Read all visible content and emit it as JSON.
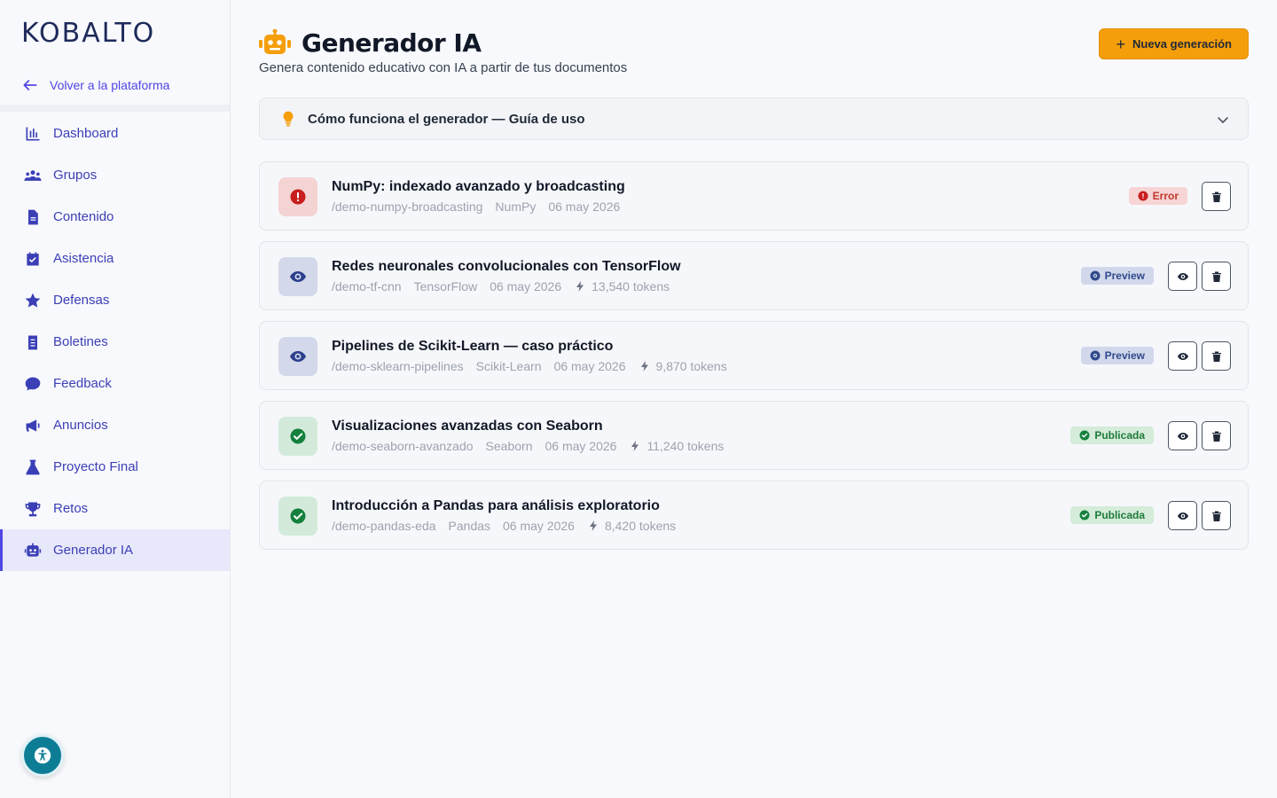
{
  "brand": {
    "logo_text": "KOBALTO"
  },
  "sidebar": {
    "back_label": "Volver a la plataforma",
    "items": [
      {
        "label": "Dashboard",
        "icon": "chart-icon"
      },
      {
        "label": "Grupos",
        "icon": "users-icon"
      },
      {
        "label": "Contenido",
        "icon": "document-icon"
      },
      {
        "label": "Asistencia",
        "icon": "calendar-check-icon"
      },
      {
        "label": "Defensas",
        "icon": "star-icon"
      },
      {
        "label": "Boletines",
        "icon": "clipboard-icon"
      },
      {
        "label": "Feedback",
        "icon": "comment-icon"
      },
      {
        "label": "Anuncios",
        "icon": "megaphone-icon"
      },
      {
        "label": "Proyecto Final",
        "icon": "flask-icon"
      },
      {
        "label": "Retos",
        "icon": "trophy-icon"
      },
      {
        "label": "Generador IA",
        "icon": "robot-icon",
        "active": true
      }
    ]
  },
  "header": {
    "title": "Generador IA",
    "subtitle": "Genera contenido educativo con IA a partir de tus documentos",
    "new_button": "Nueva generación"
  },
  "guide": {
    "label": "Cómo funciona el generador — Guía de uso"
  },
  "generations": [
    {
      "title": "NumPy: indexado avanzado y broadcasting",
      "slug": "/demo-numpy-broadcasting",
      "topic": "NumPy",
      "date": "06 may 2026",
      "tokens": "",
      "status": "Error",
      "status_type": "error"
    },
    {
      "title": "Redes neuronales convolucionales con TensorFlow",
      "slug": "/demo-tf-cnn",
      "topic": "TensorFlow",
      "date": "06 may 2026",
      "tokens": "13,540 tokens",
      "status": "Preview",
      "status_type": "preview"
    },
    {
      "title": "Pipelines de Scikit-Learn — caso práctico",
      "slug": "/demo-sklearn-pipelines",
      "topic": "Scikit-Learn",
      "date": "06 may 2026",
      "tokens": "9,870 tokens",
      "status": "Preview",
      "status_type": "preview"
    },
    {
      "title": "Visualizaciones avanzadas con Seaborn",
      "slug": "/demo-seaborn-avanzado",
      "topic": "Seaborn",
      "date": "06 may 2026",
      "tokens": "11,240 tokens",
      "status": "Publicada",
      "status_type": "published"
    },
    {
      "title": "Introducción a Pandas para análisis exploratorio",
      "slug": "/demo-pandas-eda",
      "topic": "Pandas",
      "date": "06 may 2026",
      "tokens": "8,420 tokens",
      "status": "Publicada",
      "status_type": "published"
    }
  ],
  "colors": {
    "accent": "#4f46e5",
    "primary_button": "#f59e0b",
    "error": "#c0392b",
    "preview": "#2f4a8a",
    "published": "#1f7a3a"
  }
}
